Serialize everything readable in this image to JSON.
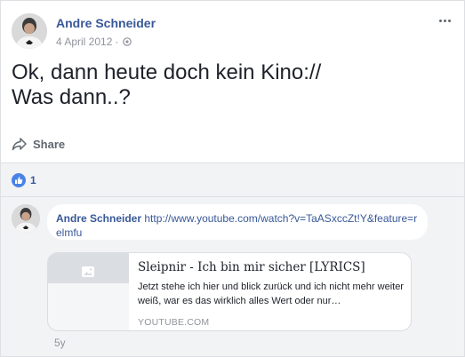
{
  "post": {
    "author": "Andre Schneider",
    "date": "4 April 2012",
    "separator": "·",
    "text": "Ok, dann heute doch kein Kino://\nWas dann..?",
    "share_label": "Share"
  },
  "reactions": {
    "count": "1"
  },
  "comment": {
    "author": "Andre Schneider",
    "link": "http://www.youtube.com/watch?v=TaASxccZt!Y&feature=relmfu",
    "time": "5y"
  },
  "preview": {
    "title": "Sleipnir - Ich bin mir sicher [LYRICS]",
    "description": "Jetzt stehe ich hier und blick zurück und ich nicht mehr weiter weiß, war es das wirklich alles Wert oder nur…",
    "domain": "YOUTUBE.COM"
  },
  "colors": {
    "link_blue": "#385898",
    "like_blue": "#4a83e8",
    "secondary_text": "#90949c",
    "comments_bg": "#f2f3f5"
  }
}
